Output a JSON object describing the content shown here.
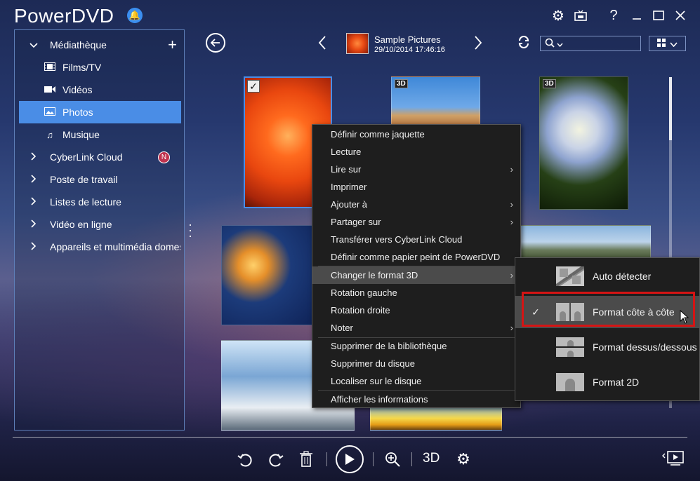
{
  "app": {
    "title": "PowerDVD"
  },
  "titlebar": {
    "icons": [
      "bell-icon",
      "gear-icon",
      "tv-icon",
      "help-icon",
      "minimize-icon",
      "maximize-icon",
      "close-icon"
    ],
    "help": "?"
  },
  "sidebar": {
    "items": [
      {
        "label": "Médiathèque",
        "expanded": true
      },
      {
        "label": "Films/TV",
        "icon": "film-icon"
      },
      {
        "label": "Vidéos",
        "icon": "camera-icon"
      },
      {
        "label": "Photos",
        "icon": "photo-icon",
        "selected": true
      },
      {
        "label": "Musique",
        "icon": "music-icon"
      },
      {
        "label": "CyberLink Cloud",
        "badge": "N"
      },
      {
        "label": "Poste de travail"
      },
      {
        "label": "Listes de lecture"
      },
      {
        "label": "Vidéo en ligne"
      },
      {
        "label": "Appareils et multimédia domestiques"
      }
    ]
  },
  "header": {
    "album_title": "Sample Pictures",
    "album_date": "29/10/2014 17:46:16",
    "search_placeholder": ""
  },
  "photos": [
    {
      "name": "dahlia",
      "tag": "3D",
      "selected": true
    },
    {
      "name": "desert",
      "tag": "3D"
    },
    {
      "name": "hydrangeas",
      "tag": "3D"
    },
    {
      "name": "jellyfish"
    },
    {
      "name": "lighthouse"
    },
    {
      "name": "penguins"
    },
    {
      "name": "tulips"
    }
  ],
  "context_menu": {
    "items": [
      {
        "label": "Définir comme jaquette"
      },
      {
        "label": "Lecture"
      },
      {
        "label": "Lire sur",
        "submenu": true
      },
      {
        "label": "Imprimer"
      },
      {
        "label": "Ajouter à",
        "submenu": true
      },
      {
        "label": "Partager sur",
        "submenu": true
      },
      {
        "label": "Transférer vers CyberLink Cloud"
      },
      {
        "label": "Définir comme papier peint de PowerDVD"
      },
      {
        "label": "Changer le format 3D",
        "submenu": true,
        "highlighted": true
      },
      {
        "label": "Rotation gauche"
      },
      {
        "label": "Rotation droite"
      },
      {
        "label": "Noter",
        "submenu": true
      },
      {
        "label": "Supprimer de la bibliothèque"
      },
      {
        "label": "Supprimer du disque"
      },
      {
        "label": "Localiser sur le disque"
      },
      {
        "label": "Afficher les informations"
      }
    ],
    "arrow": "›"
  },
  "submenu_3d": {
    "items": [
      {
        "label": "Auto détecter"
      },
      {
        "label": "Format côte à côte",
        "checked": true,
        "highlighted": true
      },
      {
        "label": "Format dessus/dessous"
      },
      {
        "label": "Format 2D"
      }
    ],
    "check_mark": "✓"
  },
  "controls": {
    "label_3d": "3D",
    "icons": [
      "rotate-left-icon",
      "rotate-right-icon",
      "trash-icon",
      "play-icon",
      "zoom-icon",
      "3d-label",
      "settings-icon",
      "mini-player-icon"
    ]
  }
}
